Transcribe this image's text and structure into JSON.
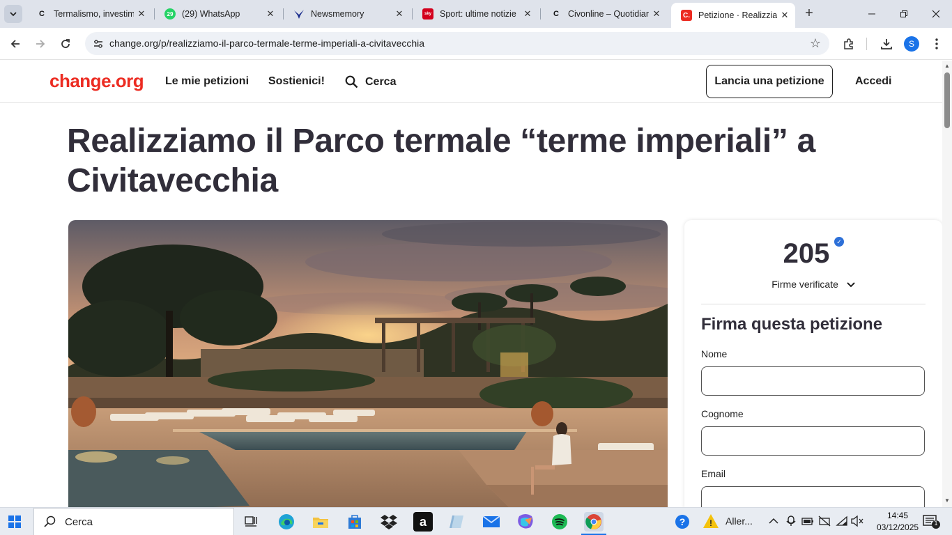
{
  "browser": {
    "tabs": [
      {
        "title": "Termalismo, investime",
        "favicon": "C",
        "active": false
      },
      {
        "title": "(29) WhatsApp",
        "favicon": "29",
        "active": false
      },
      {
        "title": "Newsmemory",
        "favicon": "bird-icon",
        "active": false
      },
      {
        "title": "Sport: ultime notizie",
        "favicon": "sky",
        "active": false
      },
      {
        "title": "Civonline – Quotidian",
        "favicon": "C",
        "active": false
      },
      {
        "title": "Petizione · Realizziam",
        "favicon": "C.",
        "active": true
      }
    ],
    "url": "change.org/p/realizziamo-il-parco-termale-terme-imperiali-a-civitavecchia",
    "profile_initial": "S"
  },
  "site": {
    "logo": "change.org",
    "nav": {
      "my_petitions": "Le mie petizioni",
      "support": "Sostienici!",
      "search": "Cerca",
      "launch": "Lancia una petizione",
      "login": "Accedi"
    },
    "brand_color": "#ec2c22"
  },
  "petition": {
    "title": "Realizziamo il Parco termale “terme imperiali” a Civitavecchia",
    "signature_count": "205",
    "signature_label": "Firme verificate",
    "sign_heading": "Firma questa petizione",
    "fields": {
      "first_name": "Nome",
      "last_name": "Cognome",
      "email": "Email"
    }
  },
  "taskbar": {
    "search_label": "Cerca",
    "weather_label": "Aller...",
    "time": "14:45",
    "date": "03/12/2025",
    "notification_count": "1"
  }
}
